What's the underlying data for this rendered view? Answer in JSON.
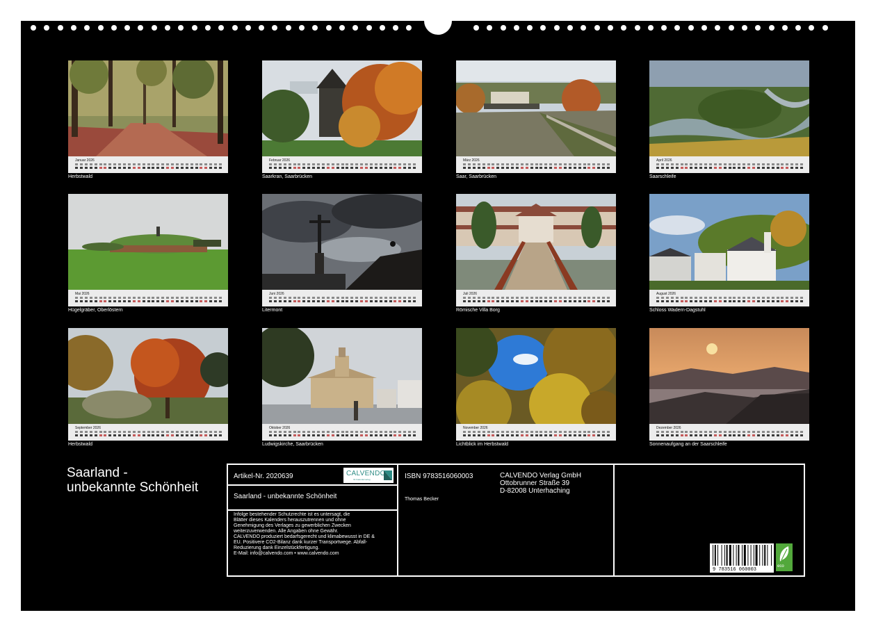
{
  "title_lines": [
    "Saarland -",
    "unbekannte Schönheit"
  ],
  "months": [
    {
      "label": "Januar 2026",
      "caption": "Herbstwald",
      "photo": "autumn-forest-path"
    },
    {
      "label": "Februar 2026",
      "caption": "Saarkran, Saarbrücken",
      "photo": "historic-crane-autumn"
    },
    {
      "label": "März 2026",
      "caption": "Saar, Saarbrücken",
      "photo": "river-saar-city"
    },
    {
      "label": "April 2026",
      "caption": "Saarschleife",
      "photo": "saar-loop-aerial"
    },
    {
      "label": "Mai 2026",
      "caption": "Hügelgräber, Oberlöstern",
      "photo": "burial-mound-meadow"
    },
    {
      "label": "Juni 2026",
      "caption": "Litermont",
      "photo": "summit-cross-clouds"
    },
    {
      "label": "Juli 2026",
      "caption": "Römische Villa Borg",
      "photo": "roman-villa-bridge"
    },
    {
      "label": "August 2026",
      "caption": "Schloss Wadern-Dagstuhl",
      "photo": "castle-on-hill"
    },
    {
      "label": "September 2026",
      "caption": "Herbstwald",
      "photo": "red-autumn-tree"
    },
    {
      "label": "Oktober 2026",
      "caption": "Ludwigskirche, Saarbrücken",
      "photo": "baroque-church-square"
    },
    {
      "label": "November 2026",
      "caption": "Lichtblick im Herbstwald",
      "photo": "looking-up-autumn-canopy"
    },
    {
      "label": "Dezember 2026",
      "caption": "Sonnenaufgang an der Saarschleife",
      "photo": "sunrise-misty-hills"
    }
  ],
  "info": {
    "article": "Artikel-Nr. 2020639",
    "logo": "CALVENDO",
    "logo_sub": "Ihr Kalenderverlag",
    "calendar_title": "Saarland - unbekannte Schönheit",
    "isbn": "ISBN 9783516060003",
    "author": "Thomas Becker",
    "publisher_lines": [
      "CALVENDO Verlag GmbH",
      "Ottobrunner Straße 39",
      "D-82008 Unterhaching"
    ],
    "legal_lines": [
      "Infolge bestehender Schutzrechte ist es untersagt, die",
      "Blätter dieses Kalenders herauszutrennen und ohne",
      "Genehmigung des Verlages zu gewerblichen Zwecken",
      "weiterzuverwenden. Alle Angaben ohne Gewähr.",
      "CALVENDO produziert bedarfsgerecht und klimabewusst in DE &",
      "EU. Positivere CO2-Bilanz dank kurzer Transportwege. Abfall-",
      "Reduzierung dank Einzelstückfertigung.",
      "E-Mail: info@calvendo.com • www.calvendo.com"
    ],
    "barcode_number": "9 783516 060003",
    "eco_label": "eco"
  },
  "colors": {
    "sheet": "#000000",
    "strip": "#ececec",
    "weekend": "#c45a5a",
    "logo": "#2e8c85",
    "eco": "#52a83b"
  }
}
